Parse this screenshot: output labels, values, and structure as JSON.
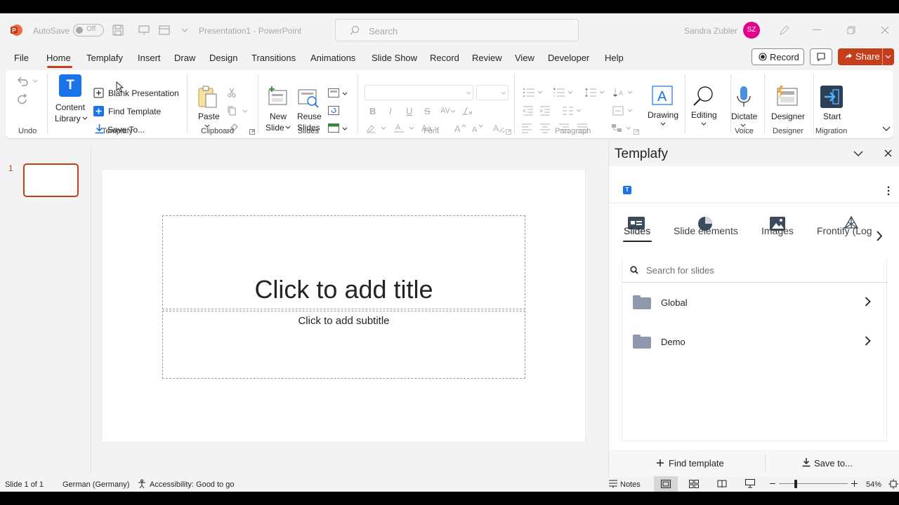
{
  "titlebar": {
    "autosave_label": "AutoSave",
    "autosave_state": "Off",
    "doc_title": "Presentation1 - PowerPoint",
    "search_placeholder": "Search",
    "user_name": "Sandra Zubler",
    "user_initials": "SZ"
  },
  "menu": {
    "tabs": [
      "File",
      "Home",
      "Templafy",
      "Insert",
      "Draw",
      "Design",
      "Transitions",
      "Animations",
      "Slide Show",
      "Record",
      "Review",
      "View",
      "Developer",
      "Help"
    ],
    "active": "Home",
    "record_label": "Record",
    "share_label": "Share"
  },
  "ribbon": {
    "undo_label": "Undo",
    "templafy_group": "Templafy",
    "content_library_line1": "Content",
    "content_library_line2": "Library",
    "blank_presentation": "Blank Presentation",
    "find_template": "Find Template",
    "save_to": "Save To...",
    "clipboard_group": "Clipboard",
    "paste": "Paste",
    "slides_group": "Slides",
    "new_slide_line1": "New",
    "new_slide_line2": "Slide",
    "reuse_slides_line1": "Reuse",
    "reuse_slides_line2": "Slides",
    "font_group": "Font",
    "paragraph_group": "Paragraph",
    "drawing": "Drawing",
    "editing": "Editing",
    "dictate": "Dictate",
    "voice_group": "Voice",
    "designer": "Designer",
    "designer_group": "Designer",
    "start": "Start",
    "migration_group": "Migration",
    "font_buttons": [
      "B",
      "I",
      "U",
      "S"
    ]
  },
  "slides_panel": {
    "slide_number": "1"
  },
  "slide": {
    "title_placeholder": "Click to add title",
    "subtitle_placeholder": "Click to add subtitle"
  },
  "pane": {
    "title": "Templafy",
    "tabs": [
      "Slides",
      "Slide elements",
      "Images",
      "Frontify (Log"
    ],
    "active_tab": "Slides",
    "search_placeholder": "Search for slides",
    "folders": [
      "Global",
      "Demo"
    ],
    "find_template": "Find template",
    "save_to": "Save to..."
  },
  "status": {
    "slide_info": "Slide 1 of 1",
    "language": "German (Germany)",
    "accessibility": "Accessibility: Good to go",
    "notes": "Notes",
    "zoom": "54%"
  },
  "colors": {
    "accent": "#c43e1c",
    "templafy_blue": "#1a73e8",
    "avatar": "#e3008c",
    "folder": "#8e99ad"
  }
}
